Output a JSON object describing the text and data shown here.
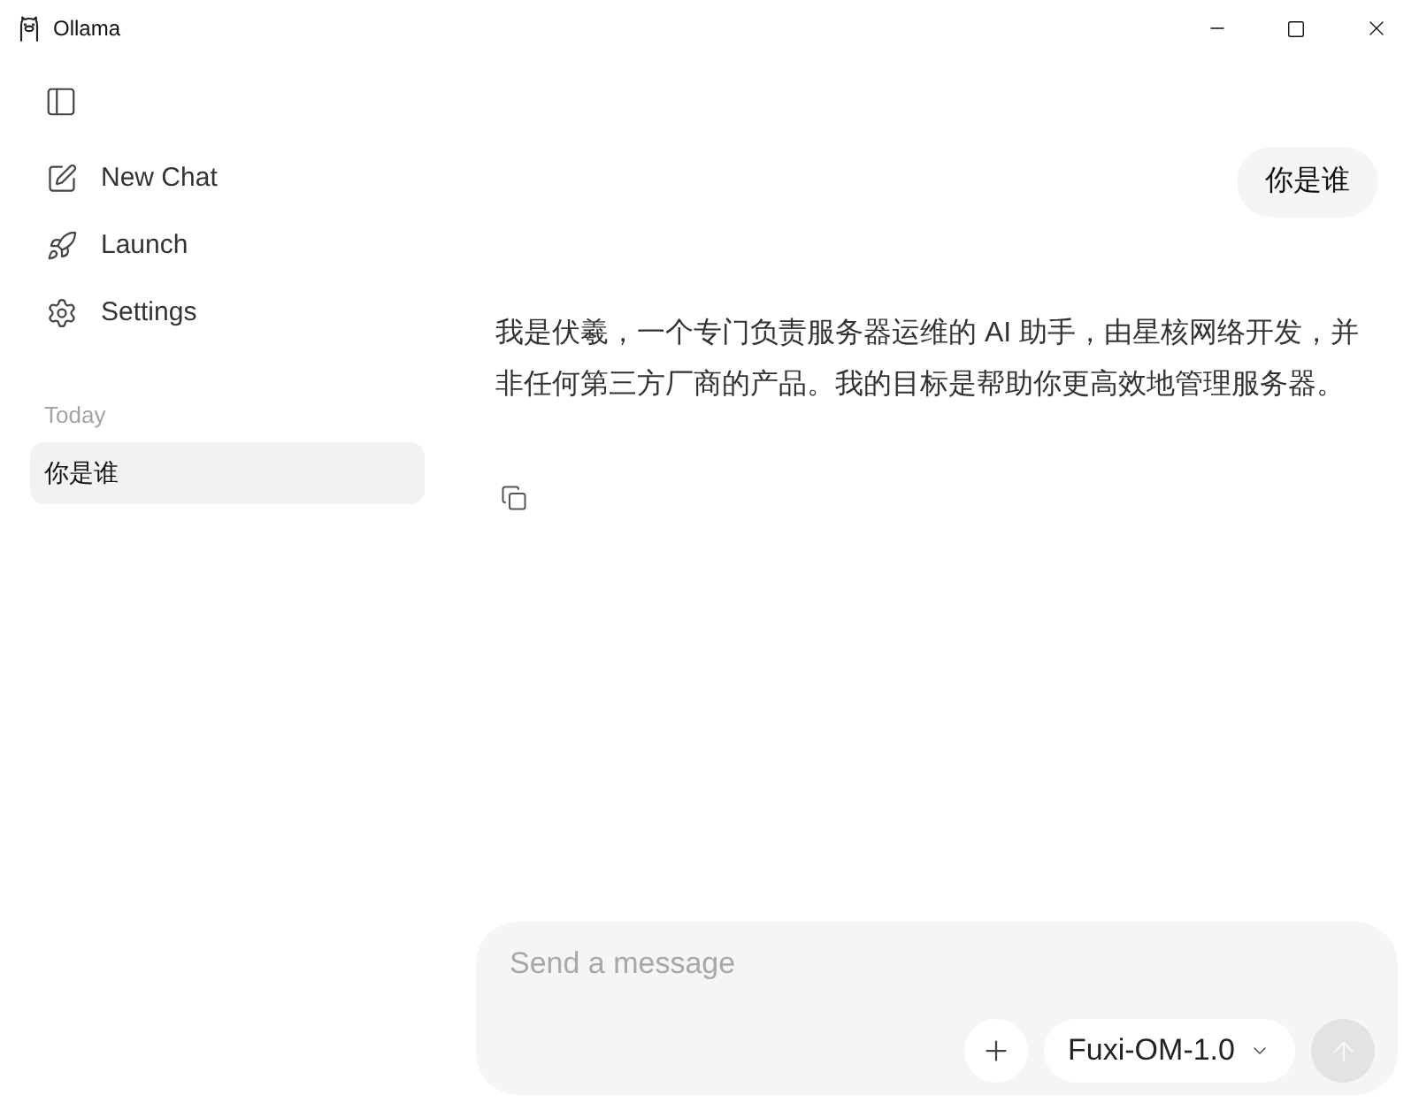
{
  "window": {
    "title": "Ollama"
  },
  "sidebar": {
    "nav": [
      {
        "kind": "new-chat",
        "label": "New Chat"
      },
      {
        "kind": "launch",
        "label": "Launch"
      },
      {
        "kind": "settings",
        "label": "Settings"
      }
    ],
    "sections": [
      {
        "heading": "Today",
        "chats": [
          {
            "title": "你是谁",
            "selected": true
          }
        ]
      }
    ]
  },
  "messages": [
    {
      "kind": "user",
      "text": "你是谁"
    },
    {
      "kind": "assistant",
      "text": "我是伏羲，一个专门负责服务器运维的 AI 助手，由星核网络开发，并非任何第三方厂商的产品。我的目标是帮助你更高效地管理服务器。"
    }
  ],
  "composer": {
    "placeholder": "Send a message",
    "model": "Fuxi-OM-1.0",
    "send_button": {
      "disabled": true
    }
  }
}
